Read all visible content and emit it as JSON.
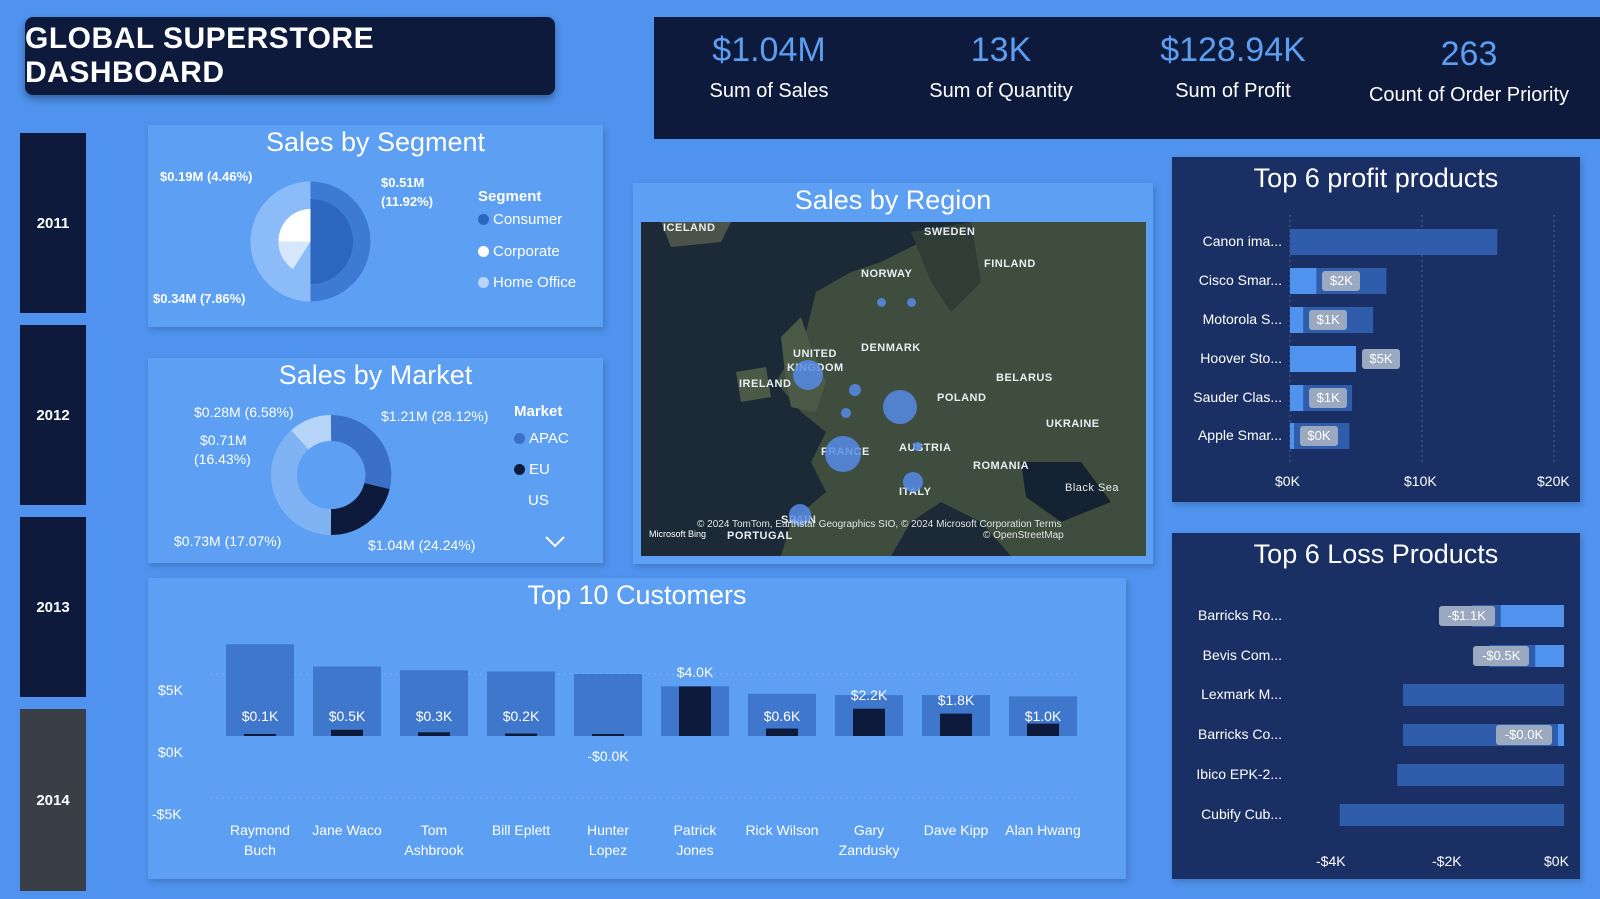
{
  "title": "GLOBAL SUPERSTORE DASHBOARD",
  "kpis": [
    {
      "value": "$1.04M",
      "label": "Sum of Sales"
    },
    {
      "value": "13K",
      "label": "Sum of Quantity"
    },
    {
      "value": "$128.94K",
      "label": "Sum of Profit"
    },
    {
      "value": "263",
      "label": "Count of Order Priority"
    }
  ],
  "years": [
    "2011",
    "2012",
    "2013",
    "2014"
  ],
  "selected_year": "2014",
  "segment": {
    "title": "Sales by Segment",
    "legend_title": "Segment",
    "legend": [
      "Consumer",
      "Corporate",
      "Home Office"
    ],
    "labels": [
      "$0.19M (4.46%)",
      "$0.51M",
      "(11.92%)",
      "$0.34M (7.86%)"
    ]
  },
  "market": {
    "title": "Sales by Market",
    "legend_title": "Market",
    "legend": [
      "APAC",
      "EU",
      "US"
    ],
    "labels": [
      "$0.28M (6.58%)",
      "$1.21M (28.12%)",
      "$0.71M",
      "(16.43%)",
      "$0.73M (17.07%)",
      "$1.04M (24.24%)"
    ]
  },
  "region": {
    "title": "Sales by Region",
    "places": [
      "ICELAND",
      "SWEDEN",
      "FINLAND",
      "NORWAY",
      "DENMARK",
      "UNITED",
      "KINGDOM",
      "IRELAND",
      "BELARUS",
      "POLAND",
      "UKRAINE",
      "FRANCE",
      "AUSTRIA",
      "ROMANIA",
      "ITALY",
      "Black Sea",
      "PORTUGAL",
      "SPAIN"
    ],
    "attribution": "© 2024 TomTom, Earthstar Geographics SIO, © 2024 Microsoft Corporation  Terms",
    "osm": "© OpenStreetMap",
    "brand": "Microsoft Bing"
  },
  "customers": {
    "title": "Top 10 Customers",
    "yticks": [
      "$5K",
      "$0K",
      "-$5K"
    ],
    "names": [
      [
        "Raymond",
        "Buch"
      ],
      [
        "Jane Waco",
        ""
      ],
      [
        "Tom",
        "Ashbrook"
      ],
      [
        "Bill Eplett",
        ""
      ],
      [
        "Hunter",
        "Lopez"
      ],
      [
        "Patrick",
        "Jones"
      ],
      [
        "Rick Wilson",
        ""
      ],
      [
        "Gary",
        "Zandusky"
      ],
      [
        "Dave Kipp",
        ""
      ],
      [
        "Alan Hwang",
        ""
      ]
    ],
    "labels": [
      "$0.1K",
      "$0.5K",
      "$0.3K",
      "$0.2K",
      "-$0.0K",
      "$4.0K",
      "$0.6K",
      "$2.2K",
      "$1.8K",
      "$1.0K"
    ]
  },
  "chart_data": [
    {
      "type": "bar",
      "title": "Top 10 Customers",
      "categories": [
        "Raymond Buch",
        "Jane Waco",
        "Tom Ashbrook",
        "Bill Eplett",
        "Hunter Lopez",
        "Patrick Jones",
        "Rick Wilson",
        "Gary Zandusky",
        "Dave Kipp",
        "Alan Hwang"
      ],
      "series": [
        {
          "values": [
            7.4,
            5.6,
            5.3,
            5.2,
            5.0,
            4.0,
            3.4,
            3.3,
            3.3,
            3.2
          ]
        },
        {
          "values": [
            0.1,
            0.5,
            0.3,
            0.2,
            -0.0,
            4.0,
            0.6,
            2.2,
            1.8,
            1.0
          ]
        }
      ],
      "ylim": [
        -5,
        10
      ]
    },
    {
      "type": "bar",
      "title": "Top 6 profit products",
      "categories": [
        "Canon ima...",
        "Cisco Smar...",
        "Motorola S...",
        "Hoover Sto...",
        "Sauder Clas...",
        "Apple Smar..."
      ],
      "series": [
        {
          "values": [
            15.7,
            7.3,
            6.3,
            5.0,
            4.7,
            4.5
          ]
        },
        {
          "values": [
            null,
            2,
            1,
            5,
            1,
            0
          ]
        }
      ],
      "value_labels": [
        "",
        "$2K",
        "$1K",
        "$5K",
        "$1K",
        "$0K"
      ],
      "xticks": [
        "$0K",
        "$10K",
        "$20K"
      ],
      "xlim": [
        0,
        20
      ]
    },
    {
      "type": "bar",
      "title": "Top 6 Loss Products",
      "categories": [
        "Barricks Ro...",
        "Bevis Com...",
        "Lexmark M...",
        "Barricks Co...",
        "Ibico EPK-2...",
        "Cubify Cub..."
      ],
      "series": [
        {
          "values": [
            -1.6,
            -1.3,
            -2.8,
            -2.8,
            -2.9,
            -3.9
          ]
        },
        {
          "values": [
            -1.1,
            -0.5,
            null,
            -0.0,
            null,
            null
          ]
        }
      ],
      "value_labels": [
        "-$1.1K",
        "-$0.5K",
        "",
        "-$0.0K",
        "",
        ""
      ],
      "xticks": [
        "-$4K",
        "-$2K",
        "$0K"
      ],
      "xlim": [
        -4.8,
        0
      ]
    }
  ],
  "profit": {
    "title": "Top 6 profit products",
    "names": [
      "Canon ima...",
      "Cisco Smar...",
      "Motorola S...",
      "Hoover Sto...",
      "Sauder Clas...",
      "Apple Smar..."
    ],
    "labels": [
      "",
      "$2K",
      "$1K",
      "$5K",
      "$1K",
      "$0K"
    ],
    "xticks": [
      "$0K",
      "$10K",
      "$20K"
    ]
  },
  "loss": {
    "title": "Top 6 Loss Products",
    "names": [
      "Barricks Ro...",
      "Bevis Com...",
      "Lexmark M...",
      "Barricks Co...",
      "Ibico EPK-2...",
      "Cubify Cub..."
    ],
    "labels": [
      "-$1.1K",
      "-$0.5K",
      "",
      "-$0.0K",
      "",
      ""
    ],
    "xticks": [
      "-$4K",
      "-$2K",
      "$0K"
    ]
  },
  "colors": {
    "background": "#4f93ee",
    "navy": "#0d1a3c",
    "panel": "#5c9ff3",
    "accent": "#5e9ef0",
    "dark_panel": "#1a3065"
  }
}
